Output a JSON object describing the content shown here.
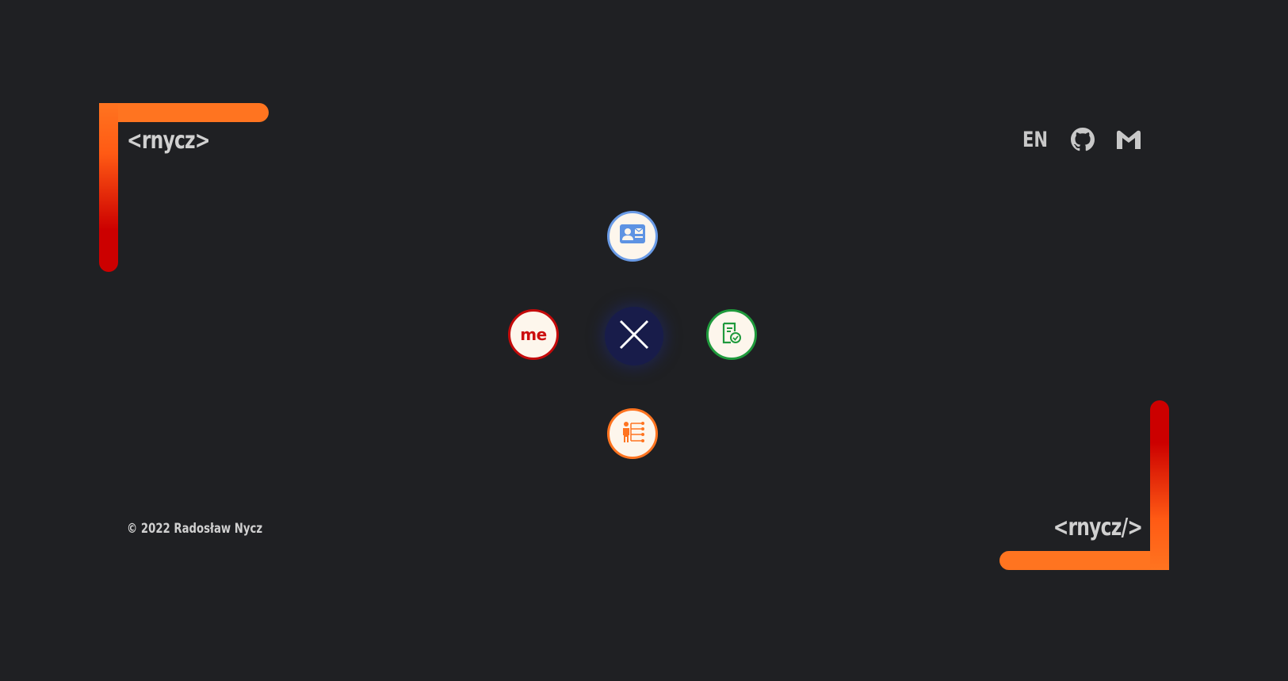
{
  "header": {
    "logo_text": "<rnycz>",
    "language_label": "EN",
    "github_icon": "github-icon",
    "gmail_icon": "gmail-icon"
  },
  "menu": {
    "center_icon": "close-icon",
    "items": [
      {
        "name": "contact",
        "icon": "contact-card-icon",
        "color": "#6a9be6"
      },
      {
        "name": "me",
        "label": "me",
        "color": "#c40a0a"
      },
      {
        "name": "cv",
        "icon": "resume-check-icon",
        "color": "#1f9a3c"
      },
      {
        "name": "skills",
        "icon": "person-tree-icon",
        "color": "#ff7420"
      }
    ]
  },
  "footer": {
    "copyright": "© 2022 Radosław Nycz",
    "closing_logo": "<rnycz/>"
  },
  "colors": {
    "background": "#1f2023",
    "accent_orange": "#ff7420",
    "accent_red": "#cc0000",
    "center_button": "#181c4a"
  }
}
